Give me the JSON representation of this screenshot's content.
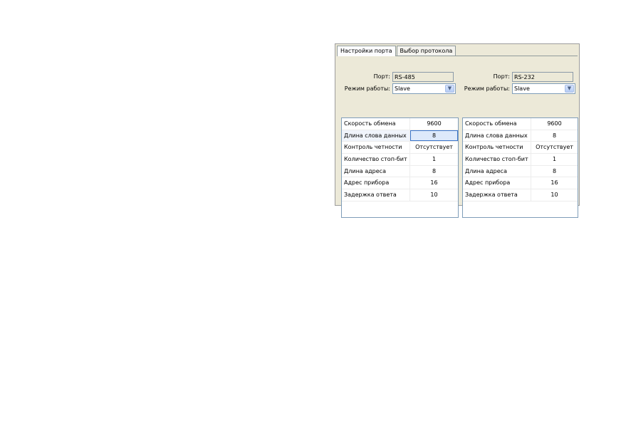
{
  "tabs": [
    "Настройки порта",
    "Выбор протокола"
  ],
  "panels": [
    {
      "port_label": "Порт:",
      "port_value": "RS-485",
      "mode_label": "Режим работы:",
      "mode_value": "Slave",
      "rows": [
        {
          "name": "Скорость обмена",
          "value": "9600"
        },
        {
          "name": "Длина слова данных",
          "value": "8"
        },
        {
          "name": "Контроль четности",
          "value": "Отсутствует"
        },
        {
          "name": "Количество стоп-бит",
          "value": "1"
        },
        {
          "name": "Длина адреса",
          "value": "8"
        },
        {
          "name": "Адрес прибора",
          "value": "16"
        },
        {
          "name": "Задержка ответа",
          "value": "10"
        }
      ]
    },
    {
      "port_label": "Порт:",
      "port_value": "RS-232",
      "mode_label": "Режим работы:",
      "mode_value": "Slave",
      "rows": [
        {
          "name": "Скорость обмена",
          "value": "9600"
        },
        {
          "name": "Длина слова данных",
          "value": "8"
        },
        {
          "name": "Контроль четности",
          "value": "Отсутствует"
        },
        {
          "name": "Количество стоп-бит",
          "value": "1"
        },
        {
          "name": "Длина адреса",
          "value": "8"
        },
        {
          "name": "Адрес прибора",
          "value": "16"
        },
        {
          "name": "Задержка ответа",
          "value": "10"
        }
      ]
    }
  ]
}
